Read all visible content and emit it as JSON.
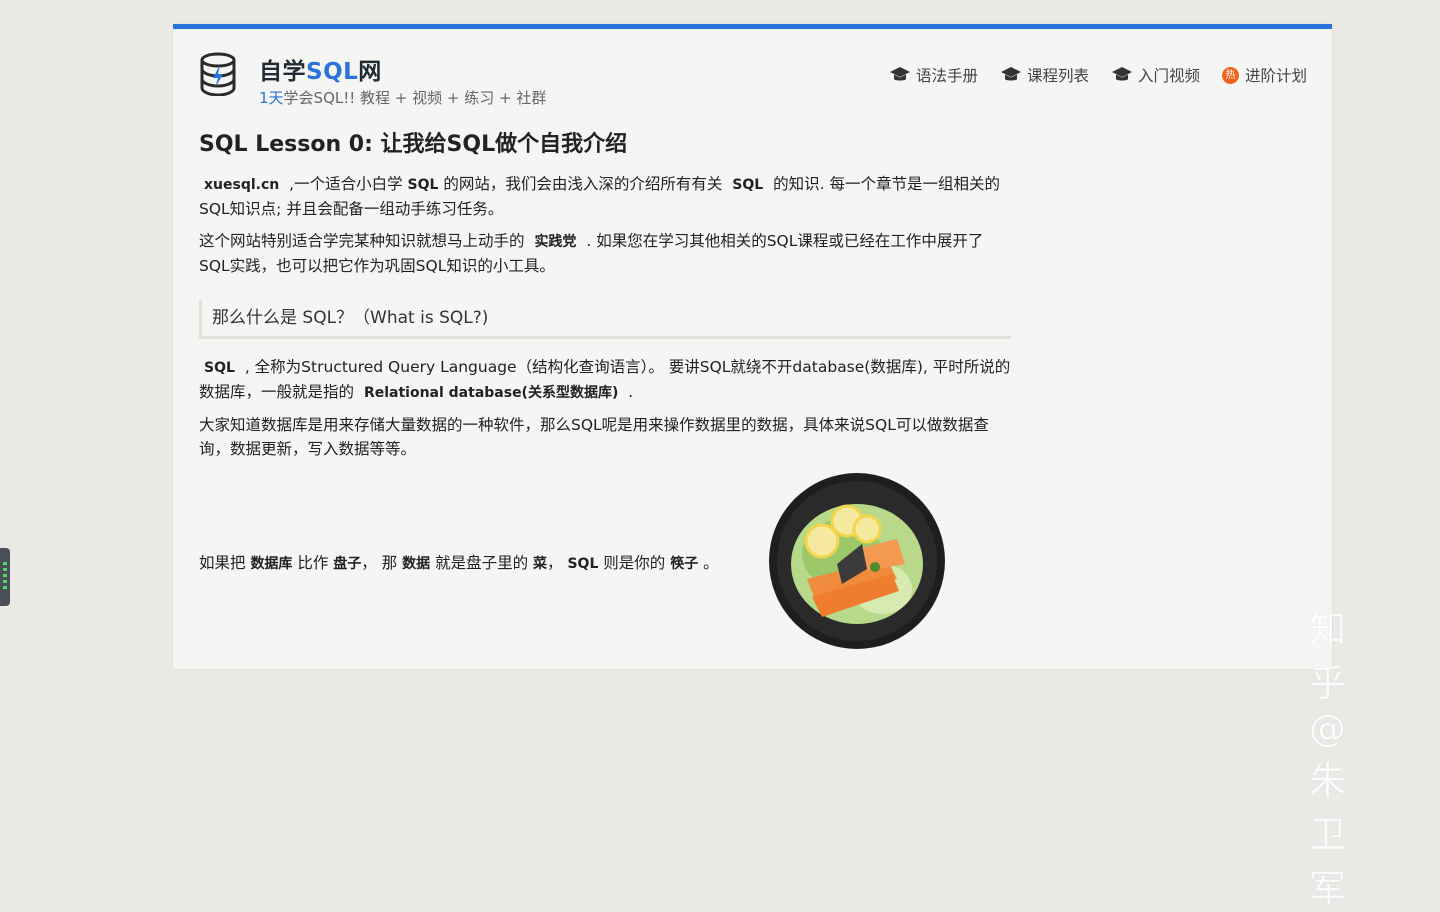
{
  "header": {
    "brand_prefix": "自学",
    "brand_sql": "SQL",
    "brand_suffix": "网",
    "subtitle_accent": "1天",
    "subtitle_rest": "学会SQL!! 教程 + 视频 + 练习 + 社群"
  },
  "nav": {
    "items": [
      {
        "label": "语法手册",
        "icon": "graduation-cap-icon"
      },
      {
        "label": "课程列表",
        "icon": "graduation-cap-icon"
      },
      {
        "label": "入门视频",
        "icon": "graduation-cap-icon"
      },
      {
        "label": "进阶计划",
        "icon": "hot-badge-icon"
      }
    ],
    "hot_badge_text": "热"
  },
  "article": {
    "title": "SQL Lesson 0: 让我给SQL做个自我介绍",
    "p1": {
      "site": "xuesql.cn",
      "t1": " ,一个适合小白学 ",
      "sql": "SQL",
      "t2": " 的网站，我们会由浅入深的介绍所有有关 ",
      "sql2": "SQL",
      "t3": " 的知识. 每一个章节是一组相关的SQL知识点; 并且会配备一组动手练习任务。"
    },
    "p2": {
      "t1": "这个网站特别适合学完某种知识就想马上动手的 ",
      "bold": "实践党",
      "t2": " . 如果您在学习其他相关的SQL课程或已经在工作中展开了SQL实践，也可以把它作为巩固SQL知识的小工具。"
    },
    "section_heading": "那么什么是 SQL？（What is SQL?)",
    "p3": {
      "sql": "SQL",
      "t1": " , 全称为Structured Query Language（结构化查询语言）。 要讲SQL就绕不开database(数据库), 平时所说的数据库，一般就是指的 ",
      "bold": "Relational database(关系型数据库)",
      "t2": " ."
    },
    "p4": "大家知道数据库是用来存储大量数据的一种软件，那么SQL呢是用来操作数据里的数据，具体来说SQL可以做数据查询，数据更新，写入数据等等。",
    "analogy": {
      "t1": "如果把 ",
      "b1": "数据库",
      "t2": " 比作 ",
      "b2": "盘子",
      "t3": "， 那 ",
      "b3": "数据",
      "t4": " 就是盘子里的 ",
      "b4": "菜",
      "t5": "， ",
      "b5": "SQL",
      "t6": " 则是你的 ",
      "b6": "筷子",
      "t7": " 。"
    }
  },
  "watermark": "知乎 @朱卫军",
  "colors": {
    "accent": "#2a73d9",
    "page_bg": "#ebe9e6",
    "card_bg": "#f5f5f4"
  }
}
